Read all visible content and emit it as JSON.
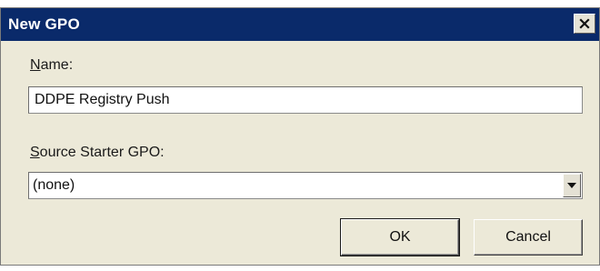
{
  "window": {
    "title": "New GPO",
    "close_glyph": "✕"
  },
  "name": {
    "label_mnemonic": "N",
    "label_rest": "ame:",
    "value": "DDPE Registry Push"
  },
  "source": {
    "label_mnemonic": "S",
    "label_rest": "ource Starter GPO:",
    "selected": "(none)"
  },
  "buttons": {
    "ok": "OK",
    "cancel": "Cancel"
  },
  "colors": {
    "titlebar": "#0a2a6a",
    "dialog_bg": "#ece9d8"
  },
  "icons": {
    "close": "close-icon",
    "dropdown": "chevron-down-icon"
  }
}
